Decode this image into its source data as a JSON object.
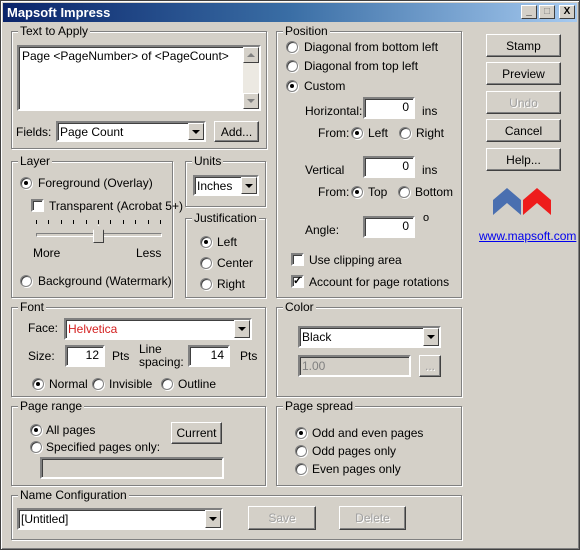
{
  "window": {
    "title": "Mapsoft Impress",
    "controls": {
      "minimize": "_",
      "maximize": "□",
      "close": "X"
    }
  },
  "text_to_apply": {
    "legend": "Text to Apply",
    "value": "Page <PageNumber> of <PageCount>",
    "fields_label": "Fields:",
    "fields_selected": "Page Count",
    "add_button": "Add..."
  },
  "layer": {
    "legend": "Layer",
    "foreground": {
      "label": "Foreground (Overlay)",
      "checked": true
    },
    "transparent": {
      "label": "Transparent (Acrobat 5+)",
      "checked": false
    },
    "slider": {
      "min_label": "More",
      "max_label": "Less",
      "value_percent": 50,
      "ticks": 11
    },
    "background": {
      "label": "Background (Watermark)",
      "checked": false
    }
  },
  "units": {
    "legend": "Units",
    "selected": "Inches"
  },
  "justification": {
    "legend": "Justification",
    "options": [
      {
        "label": "Left",
        "checked": true
      },
      {
        "label": "Center",
        "checked": false
      },
      {
        "label": "Right",
        "checked": false
      }
    ]
  },
  "position": {
    "legend": "Position",
    "options": [
      {
        "label": "Diagonal from bottom left",
        "checked": false
      },
      {
        "label": "Diagonal from top left",
        "checked": false
      },
      {
        "label": "Custom",
        "checked": true
      }
    ],
    "horizontal": {
      "label": "Horizontal:",
      "value": "0",
      "unit": "ins",
      "from_label": "From:",
      "from_options": [
        {
          "label": "Left",
          "checked": true
        },
        {
          "label": "Right",
          "checked": false
        }
      ]
    },
    "vertical": {
      "label": "Vertical",
      "value": "0",
      "unit": "ins",
      "from_label": "From:",
      "from_options": [
        {
          "label": "Top",
          "checked": true
        },
        {
          "label": "Bottom",
          "checked": false
        }
      ]
    },
    "angle": {
      "label": "Angle:",
      "value": "0",
      "unit": "o"
    },
    "use_clipping": {
      "label": "Use clipping area",
      "checked": false
    },
    "account_rotations": {
      "label": "Account for page rotations",
      "checked": true
    }
  },
  "font": {
    "legend": "Font",
    "face_label": "Face:",
    "face_value": "Helvetica",
    "face_color": "#d42020",
    "size_label": "Size:",
    "size_value": "12",
    "size_unit": "Pts",
    "line_spacing_label_1": "Line",
    "line_spacing_label_2": "spacing:",
    "line_spacing_value": "14",
    "line_spacing_unit": "Pts",
    "styles": [
      {
        "label": "Normal",
        "checked": true
      },
      {
        "label": "Invisible",
        "checked": false
      },
      {
        "label": "Outline",
        "checked": false
      }
    ]
  },
  "color": {
    "legend": "Color",
    "selected": "Black",
    "opacity_value": "1.00",
    "picker_button": "..."
  },
  "page_range": {
    "legend": "Page range",
    "options": [
      {
        "label": "All pages",
        "checked": true
      },
      {
        "label": "Specified pages only:",
        "checked": false
      }
    ],
    "current_button": "Current",
    "pages_value": ""
  },
  "page_spread": {
    "legend": "Page spread",
    "options": [
      {
        "label": "Odd and even pages",
        "checked": true
      },
      {
        "label": "Odd pages only",
        "checked": false
      },
      {
        "label": "Even pages only",
        "checked": false
      }
    ]
  },
  "name_configuration": {
    "legend": "Name Configuration",
    "selected": "[Untitled]",
    "save_button": "Save",
    "delete_button": "Delete"
  },
  "actions": {
    "stamp": "Stamp",
    "preview": "Preview",
    "undo": "Undo",
    "cancel": "Cancel",
    "help": "Help..."
  },
  "brand": {
    "logo_colors": {
      "left": "#4a6fb0",
      "right": "#ee1c1c"
    },
    "link": "www.mapsoft.com"
  }
}
